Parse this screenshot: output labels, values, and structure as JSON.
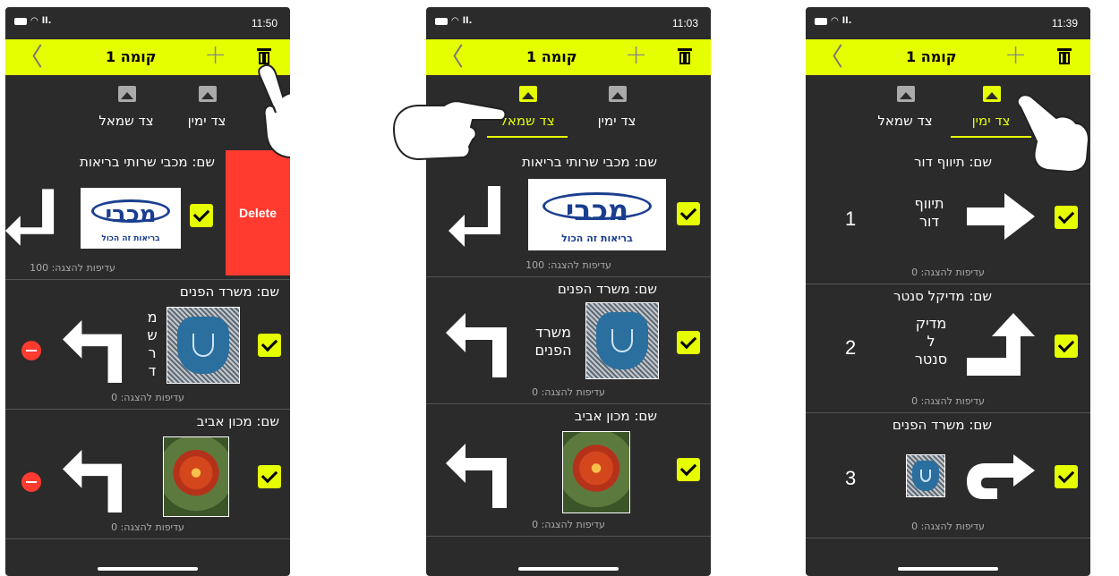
{
  "status": {
    "times": [
      "11:50",
      "11:03",
      "11:39"
    ],
    "signal": "ll.",
    "wifi": "◠"
  },
  "nav": {
    "title": "קומה 1",
    "back_glyph": "〈",
    "add_glyph": "+"
  },
  "tabs": {
    "left": "צד שמאל",
    "right": "צד ימין"
  },
  "colors": {
    "accent": "#e6ff00",
    "background": "#2b2b2b",
    "delete": "#ff3b30"
  },
  "phone1": {
    "active_tab": "none",
    "delete_label": "Delete",
    "rows": [
      {
        "name": "שם: מכבי שרותי בריאות",
        "priority": "עדיפות להצגה: 100",
        "logo_text": "מכבי",
        "logo_sub": "בריאות זה הכול",
        "icon": "arrow-down-left-icon"
      },
      {
        "name": "שם: משרד הפנים",
        "priority": "עדיפות להצגה: 0",
        "vertical_text": "מ\nש\nר\nד",
        "icon": "arrow-turn-left-icon"
      },
      {
        "name": "שם: מכון אביב",
        "priority": "עדיפות להצגה: 0",
        "icon": "arrow-turn-left-icon"
      }
    ]
  },
  "phone2": {
    "active_tab": "left",
    "rows": [
      {
        "name": "שם: מכבי שרותי בריאות",
        "priority": "עדיפות להצגה: 100",
        "logo_text": "מכבי",
        "logo_sub": "בריאות זה הכול",
        "icon": "arrow-down-left-icon"
      },
      {
        "name": "שם: משרד הפנים",
        "priority": "עדיפות להצגה: 0",
        "text_line1": "משרד",
        "text_line2": "הפנים",
        "icon": "arrow-turn-left-icon"
      },
      {
        "name": "שם: מכון אביב",
        "priority": "עדיפות להצגה: 0",
        "icon": "arrow-turn-left-icon"
      }
    ]
  },
  "phone3": {
    "active_tab": "right",
    "rows": [
      {
        "name": "שם: תיווף דור",
        "priority": "עדיפות להצגה: 0",
        "number": "1",
        "text_line1": "תיווף",
        "text_line2": "דור",
        "icon": "arrow-right-icon"
      },
      {
        "name": "שם: מדיקל סנטר",
        "priority": "עדיפות להצגה: 0",
        "number": "2",
        "text_line1": "מדיק",
        "text_line2": "ל",
        "text_line3": "סנטר",
        "icon": "arrow-up-right-turn-icon"
      },
      {
        "name": "שם: משרד הפנים",
        "priority": "עדיפות להצגה: 0",
        "number": "3",
        "icon": "arrow-u-turn-right-icon"
      }
    ]
  }
}
